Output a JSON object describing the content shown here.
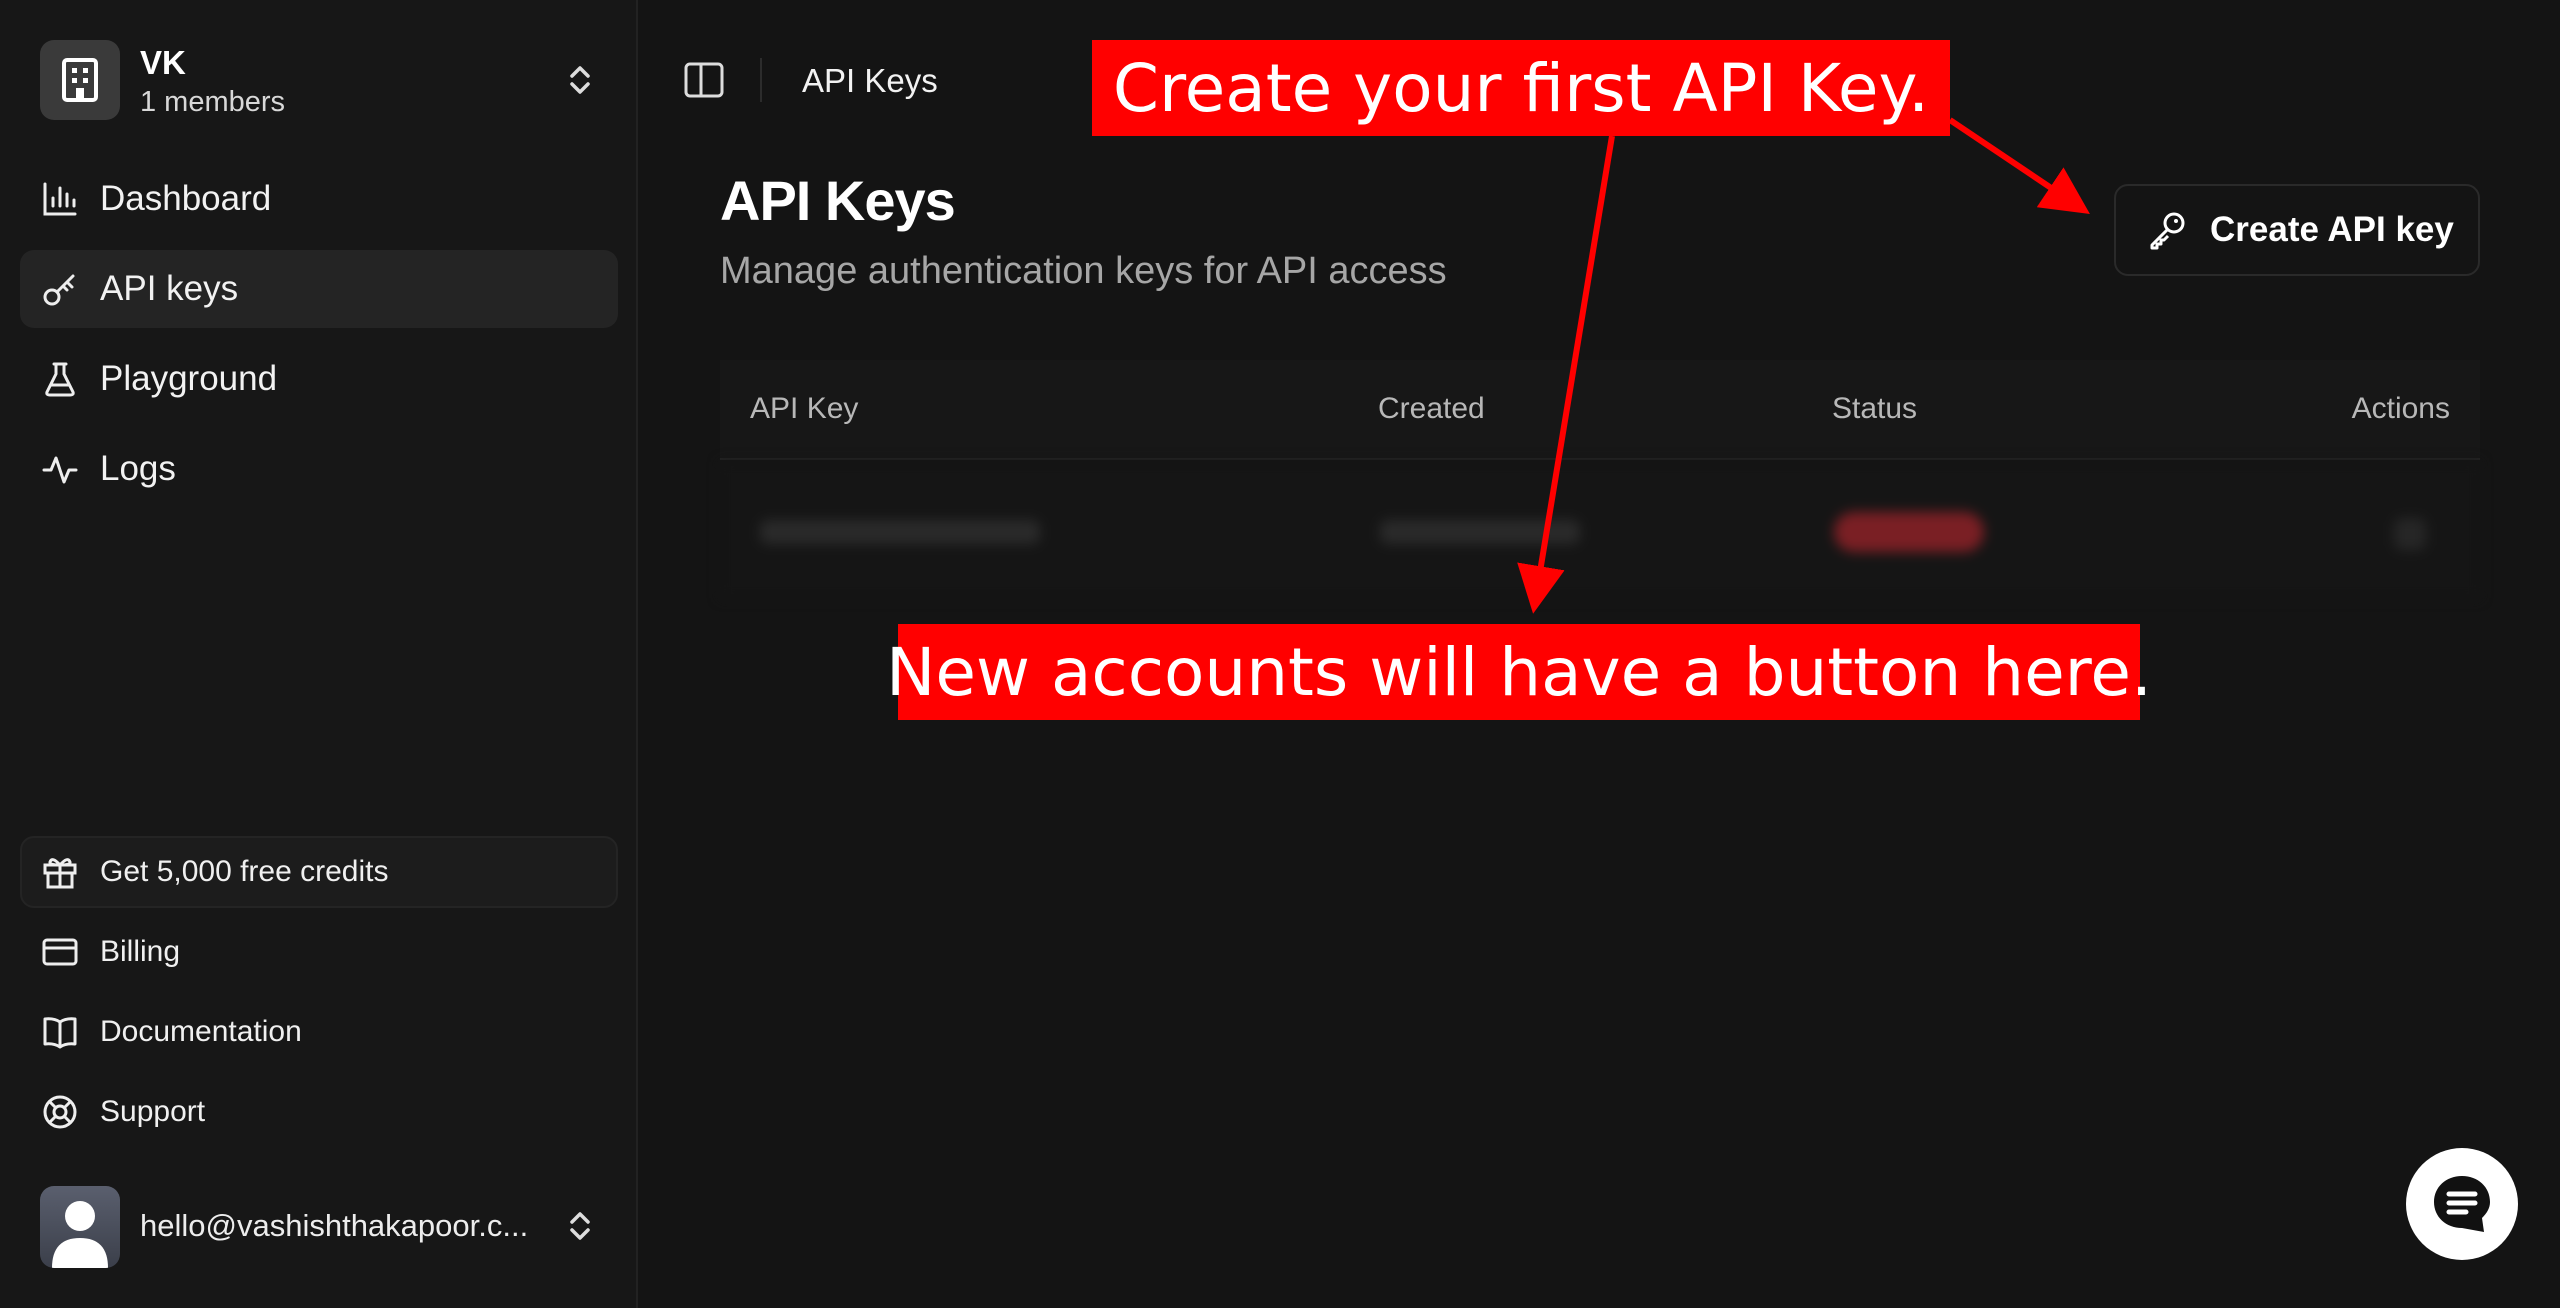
{
  "org": {
    "name": "VK",
    "members": "1 members"
  },
  "nav": {
    "items": [
      {
        "label": "Dashboard",
        "icon": "bar-chart-icon",
        "active": false
      },
      {
        "label": "API keys",
        "icon": "key-icon",
        "active": true
      },
      {
        "label": "Playground",
        "icon": "flask-icon",
        "active": false
      },
      {
        "label": "Logs",
        "icon": "activity-icon",
        "active": false
      }
    ]
  },
  "bottom_nav": {
    "credits": "Get 5,000 free credits",
    "items": [
      {
        "label": "Billing",
        "icon": "credit-card-icon"
      },
      {
        "label": "Documentation",
        "icon": "book-icon"
      },
      {
        "label": "Support",
        "icon": "lifebuoy-icon"
      }
    ]
  },
  "user": {
    "email": "hello@vashishthakapoor.c..."
  },
  "topbar": {
    "title": "API Keys"
  },
  "page": {
    "title": "API Keys",
    "subtitle": "Manage authentication keys for API access",
    "create_button": "Create API key"
  },
  "table": {
    "columns": [
      "API Key",
      "Created",
      "Status",
      "Actions"
    ]
  },
  "annotations": {
    "top": "Create your first API Key.",
    "middle": "New accounts will have a button here."
  },
  "colors": {
    "background": "#141414",
    "sidebar": "#171717",
    "annotation": "#ff0000"
  }
}
